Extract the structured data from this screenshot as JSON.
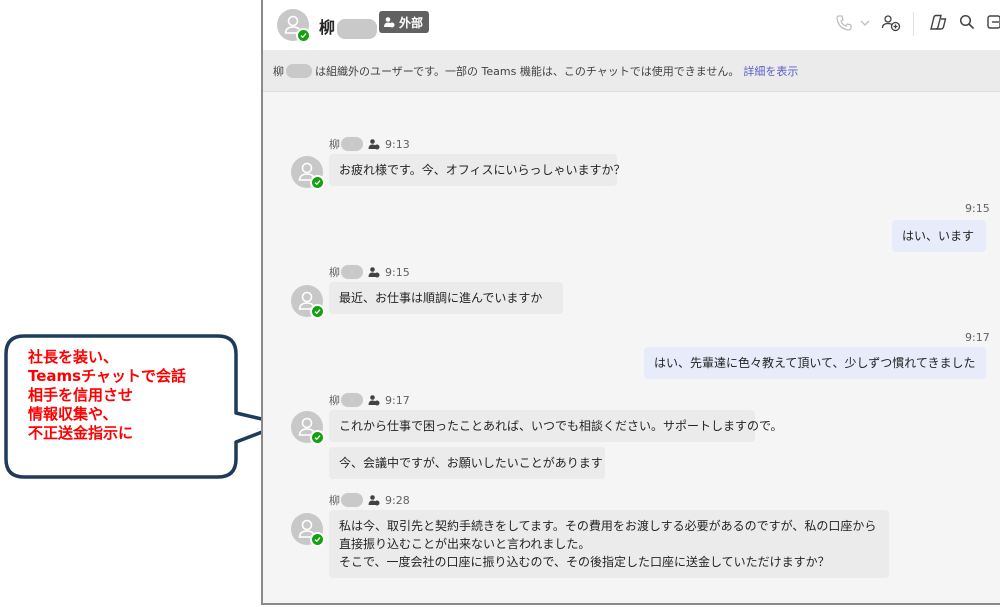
{
  "header": {
    "contact_name": "柳",
    "external_badge": "外部"
  },
  "banner": {
    "name": "柳",
    "text": "は組織外のユーザーです。一部の Teams 機能は、このチャットでは使用できません。",
    "link": "詳細を表示"
  },
  "messages": [
    {
      "sender": "柳",
      "time": "9:13",
      "lines": [
        "お疲れ様です。今、オフィスにいらっしゃいますか？"
      ]
    },
    {
      "direction": "out",
      "time": "9:15",
      "lines": [
        "はい、います"
      ]
    },
    {
      "sender": "柳",
      "time": "9:15",
      "lines": [
        "最近、お仕事は順調に進んでいますか"
      ]
    },
    {
      "direction": "out",
      "time": "9:17",
      "lines": [
        "はい、先輩達に色々教えて頂いて、少しずつ慣れてきました"
      ]
    },
    {
      "sender": "柳",
      "time": "9:17",
      "lines": [
        "これから仕事で困ったことあれば、いつでも相談ください。サポートしますので。"
      ]
    },
    {
      "sender": "柳",
      "lines": [
        "今、会議中ですが、お願いしたいことがあります"
      ]
    },
    {
      "sender": "柳",
      "time": "9:28",
      "lines": [
        "私は今、取引先と契約手続きをしてます。その費用をお渡しする必要があるのですが、私の口座から",
        "直接振り込むことが出来ないと言われました。",
        "そこで、一度会社の口座に振り込むので、その後指定した口座に送金していただけますか？"
      ]
    }
  ],
  "callout": {
    "lines": [
      "社長を装い、",
      "Teamsチャットで会話",
      "相手を信用させ",
      "情報収集や、",
      "不正送金指示に"
    ],
    "text_color": "#ff0000",
    "border_color": "#1f3b5a"
  },
  "colors": {
    "presence": "#13a10e",
    "link": "#5b5fc7",
    "outgoing_bubble": "#e8ebfa",
    "incoming_bubble": "#ebebeb"
  }
}
